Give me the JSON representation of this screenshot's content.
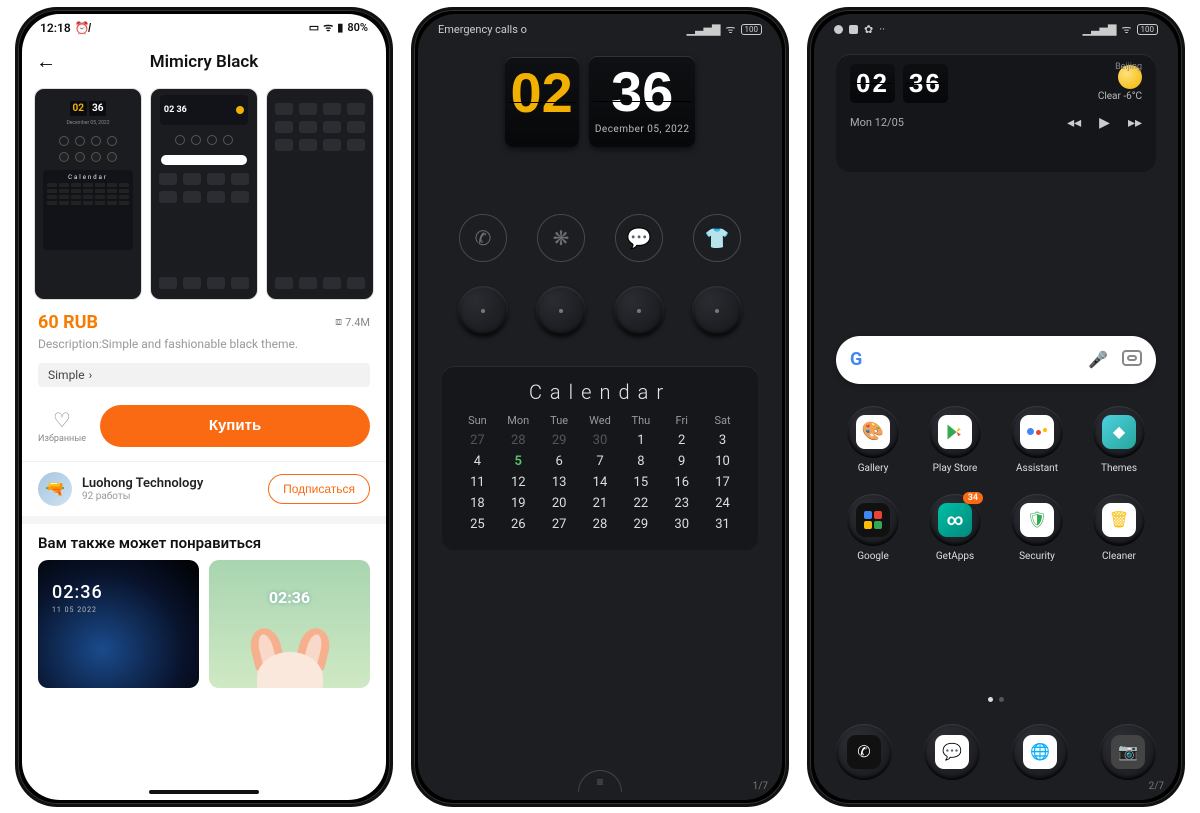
{
  "phone1": {
    "status": {
      "time": "12:18",
      "battery": "80%"
    },
    "title": "Mimicry Black",
    "price": "60 RUB",
    "size": "7.4M",
    "description": "Description:Simple and fashionable black theme.",
    "tag": "Simple",
    "favorites_label": "Избранные",
    "buy_label": "Купить",
    "developer": {
      "name": "Luohong Technology",
      "works": "92 работы"
    },
    "subscribe_label": "Подписаться",
    "recommend_heading": "Вам также может понравиться",
    "rec1_time": "02:36",
    "rec1_date": "11 05 2022",
    "rec2_time": "02:36",
    "preview_calendar": "Calendar"
  },
  "phone2": {
    "status_left": "Emergency calls o",
    "status_battery": "100",
    "clock": {
      "hours": "02",
      "minutes": "36",
      "date": "December  05, 2022"
    },
    "calendar": {
      "title": "Calendar",
      "days": [
        "Sun",
        "Mon",
        "Tue",
        "Wed",
        "Thu",
        "Fri",
        "Sat"
      ],
      "cells": [
        {
          "v": "27",
          "dim": true
        },
        {
          "v": "28",
          "dim": true
        },
        {
          "v": "29",
          "dim": true
        },
        {
          "v": "30",
          "dim": true
        },
        {
          "v": "1"
        },
        {
          "v": "2"
        },
        {
          "v": "3"
        },
        {
          "v": "4"
        },
        {
          "v": "5",
          "today": true
        },
        {
          "v": "6"
        },
        {
          "v": "7"
        },
        {
          "v": "8"
        },
        {
          "v": "9"
        },
        {
          "v": "10"
        },
        {
          "v": "11"
        },
        {
          "v": "12"
        },
        {
          "v": "13"
        },
        {
          "v": "14"
        },
        {
          "v": "15"
        },
        {
          "v": "16"
        },
        {
          "v": "17"
        },
        {
          "v": "18"
        },
        {
          "v": "19"
        },
        {
          "v": "20"
        },
        {
          "v": "21"
        },
        {
          "v": "22"
        },
        {
          "v": "23"
        },
        {
          "v": "24"
        },
        {
          "v": "25"
        },
        {
          "v": "26"
        },
        {
          "v": "27"
        },
        {
          "v": "28"
        },
        {
          "v": "29"
        },
        {
          "v": "30"
        },
        {
          "v": "31"
        }
      ]
    },
    "pager": "1/7"
  },
  "phone3": {
    "status_battery": "100",
    "widget": {
      "hours": "02",
      "minutes": "36",
      "city": "Beijing",
      "weather": "Clear  -6°C",
      "date": "Mon 12/05"
    },
    "apps_row1": [
      "Gallery",
      "Play Store",
      "Assistant",
      "Themes"
    ],
    "apps_row2": [
      "Google",
      "GetApps",
      "Security",
      "Cleaner"
    ],
    "getapps_badge": "34",
    "pager": "2/7"
  }
}
